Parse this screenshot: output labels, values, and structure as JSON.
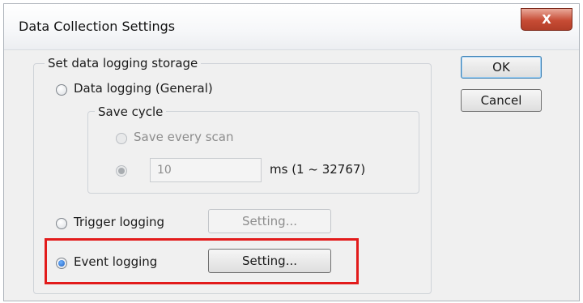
{
  "window": {
    "title": "Data Collection Settings",
    "close_label": "X"
  },
  "storage_group": {
    "title": "Set data logging storage"
  },
  "options": {
    "general": {
      "label": "Data logging (General)",
      "checked": false
    },
    "trigger": {
      "label": "Trigger logging",
      "checked": false,
      "setting_label": "Setting...",
      "setting_enabled": false
    },
    "event": {
      "label": "Event logging",
      "checked": true,
      "setting_label": "Setting...",
      "setting_enabled": true
    }
  },
  "save_cycle": {
    "title": "Save cycle",
    "every_scan_label": "Save every scan",
    "interval_value": "10",
    "interval_unit": "ms (1 ~ 32767)",
    "enabled": false
  },
  "buttons": {
    "ok": "OK",
    "cancel": "Cancel"
  },
  "colors": {
    "highlight": "#e21b1b",
    "radio_selected": "#1f5fbf",
    "close_button": "#c74c35"
  }
}
